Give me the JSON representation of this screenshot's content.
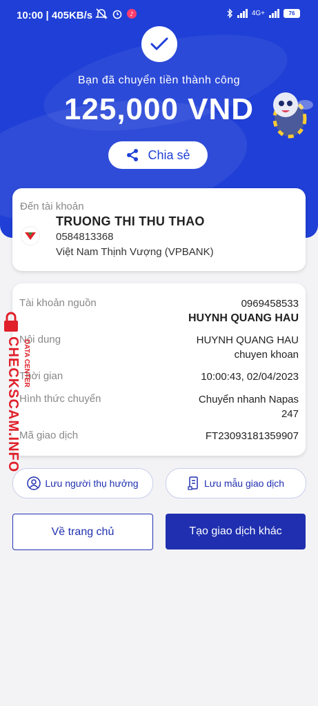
{
  "status_bar": {
    "time": "10:00",
    "speed": "405KB/s",
    "network": "4G+",
    "battery": "76"
  },
  "header": {
    "success_message": "Bạn đã chuyển tiền thành công",
    "amount": "125,000 VND",
    "share_label": "Chia sẻ"
  },
  "destination": {
    "label": "Đến tài khoản",
    "name": "TRUONG THI THU THAO",
    "account": "0584813368",
    "bank": "Việt Nam Thịnh Vượng (VPBANK)"
  },
  "details": {
    "source_label": "Tài khoản nguồn",
    "source_account": "0969458533",
    "source_name": "HUYNH QUANG HAU",
    "content_label": "Nội dung",
    "content_line1": "HUYNH QUANG HAU",
    "content_line2": "chuyen khoan",
    "time_label": "Thời gian",
    "time_value": "10:00:43, 02/04/2023",
    "method_label": "Hình thức chuyển",
    "method_line1": "Chuyển nhanh Napas",
    "method_line2": "247",
    "txn_label": "Mã giao dịch",
    "txn_value": "FT23093181359907"
  },
  "actions": {
    "save_beneficiary": "Lưu người thụ hưởng",
    "save_template": "Lưu mẫu giao dịch",
    "home": "Về trang chủ",
    "new_transaction": "Tạo giao dịch khác"
  },
  "watermark": {
    "big": "CHECKSCAM.INFO",
    "small": "DATA CENTER"
  },
  "colors": {
    "primary": "#1f3fd6",
    "button": "#1f2fb0",
    "watermark": "#e0202a"
  }
}
